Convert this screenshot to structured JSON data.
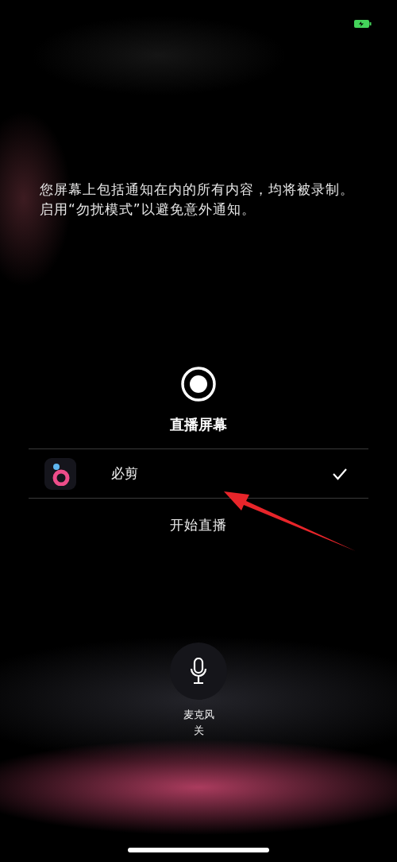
{
  "notice": "您屏幕上包括通知在内的所有内容，均将被录制。启用“勿扰模式”以避免意外通知。",
  "broadcast": {
    "title": "直播屏幕"
  },
  "apps": [
    {
      "name": "必剪",
      "selected": true
    }
  ],
  "start_button": "开始直播",
  "microphone": {
    "label": "麦克风",
    "status": "关",
    "on": false
  }
}
